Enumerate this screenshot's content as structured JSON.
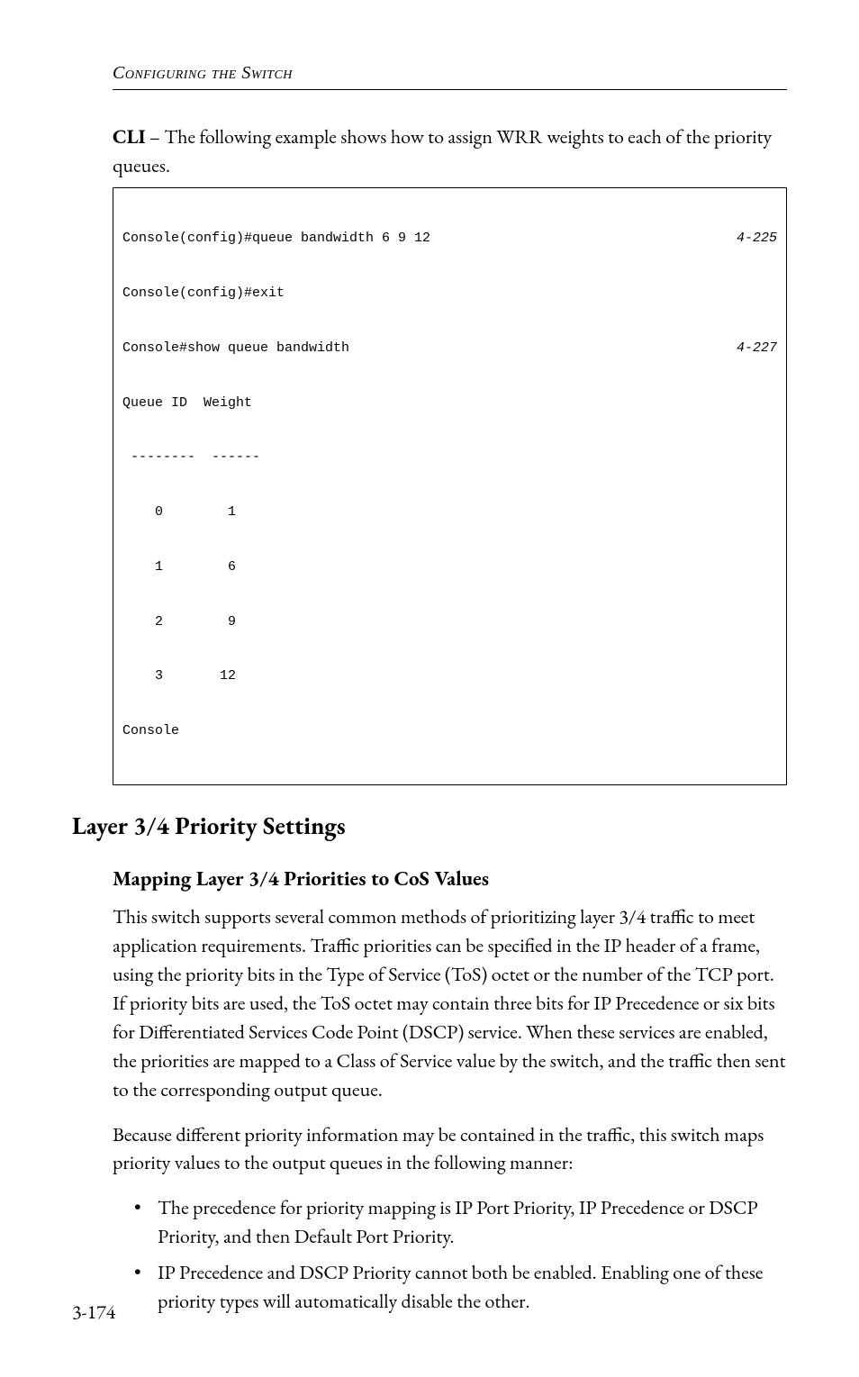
{
  "running_head": "Configuring the Switch",
  "intro_html": "<b>CLI</b> – The following example shows how to assign WRR weights to each of the priority queues.",
  "code": {
    "line1_cmd": "Console(config)#queue bandwidth 6 9 12",
    "line1_ref": "4-225",
    "line2": "Console(config)#exit",
    "line3_cmd": "Console#show queue bandwidth",
    "line3_ref": "4-227",
    "line4": "Queue ID  Weight",
    "line5": " --------  ------",
    "line6": "    0        1",
    "line7": "    1        6",
    "line8": "    2        9",
    "line9": "    3       12",
    "line10": "Console"
  },
  "h2": "Layer 3/4 Priority Settings",
  "h3": "Mapping Layer 3/4 Priorities to CoS Values",
  "para1": "This switch supports several common methods of prioritizing layer 3/4 traffic to meet application requirements. Traffic priorities can be specified in the IP header of a frame, using the priority bits in the Type of Service (ToS) octet or the number of the TCP port. If priority bits are used, the ToS octet may contain three bits for IP Precedence or six bits for Differentiated Services Code Point (DSCP) service. When these services are enabled, the priorities are mapped to a Class of Service value by the switch, and the traffic then sent to the corresponding output queue.",
  "para2": "Because different priority information may be contained in the traffic, this switch maps priority values to the output queues in the following manner:",
  "bullets": [
    "The precedence for priority mapping is IP Port Priority, IP Precedence or DSCP Priority, and then Default Port Priority.",
    "IP Precedence and DSCP Priority cannot both be enabled. Enabling one of these priority types will automatically disable the other."
  ],
  "page_number": "3-174"
}
